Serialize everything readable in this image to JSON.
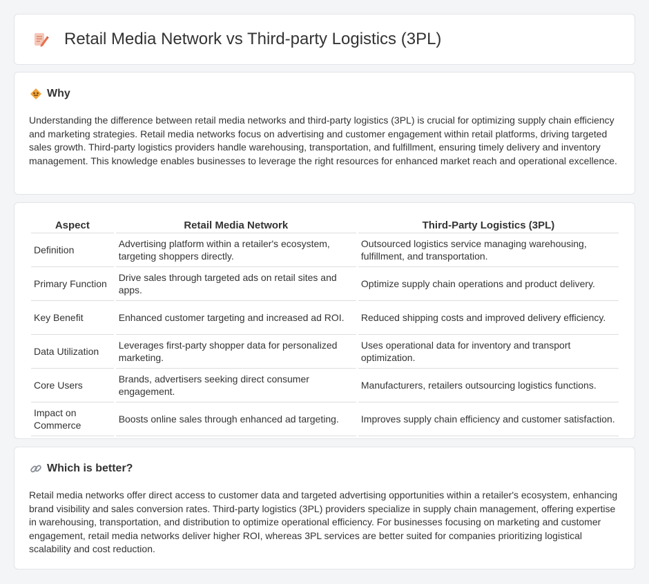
{
  "header": {
    "title": "Retail Media Network vs Third-party Logistics (3PL)",
    "icon": "document-pencil-icon"
  },
  "why": {
    "title": "Why",
    "icon": "diamond-sign-icon",
    "text": "Understanding the difference between retail media networks and third-party logistics (3PL) is crucial for optimizing supply chain efficiency and marketing strategies. Retail media networks focus on advertising and customer engagement within retail platforms, driving targeted sales growth. Third-party logistics providers handle warehousing, transportation, and fulfillment, ensuring timely delivery and inventory management. This knowledge enables businesses to leverage the right resources for enhanced market reach and operational excellence."
  },
  "table": {
    "headers": [
      "Aspect",
      "Retail Media Network",
      "Third-Party Logistics (3PL)"
    ],
    "rows": [
      [
        "Definition",
        "Advertising platform within a retailer's ecosystem, targeting shoppers directly.",
        "Outsourced logistics service managing warehousing, fulfillment, and transportation."
      ],
      [
        "Primary Function",
        "Drive sales through targeted ads on retail sites and apps.",
        "Optimize supply chain operations and product delivery."
      ],
      [
        "Key Benefit",
        "Enhanced customer targeting and increased ad ROI.",
        "Reduced shipping costs and improved delivery efficiency."
      ],
      [
        "Data Utilization",
        "Leverages first-party shopper data for personalized marketing.",
        "Uses operational data for inventory and transport optimization."
      ],
      [
        "Core Users",
        "Brands, advertisers seeking direct consumer engagement.",
        "Manufacturers, retailers outsourcing logistics functions."
      ],
      [
        "Impact on Commerce",
        "Boosts online sales through enhanced ad targeting.",
        "Improves supply chain efficiency and customer satisfaction."
      ]
    ]
  },
  "better": {
    "title": "Which is better?",
    "icon": "link-icon",
    "text": "Retail media networks offer direct access to customer data and targeted advertising opportunities within a retailer's ecosystem, enhancing brand visibility and sales conversion rates. Third-party logistics (3PL) providers specialize in supply chain management, offering expertise in warehousing, transportation, and distribution to optimize operational efficiency. For businesses focusing on marketing and customer engagement, retail media networks deliver higher ROI, whereas 3PL services are better suited for companies prioritizing logistical scalability and cost reduction."
  }
}
